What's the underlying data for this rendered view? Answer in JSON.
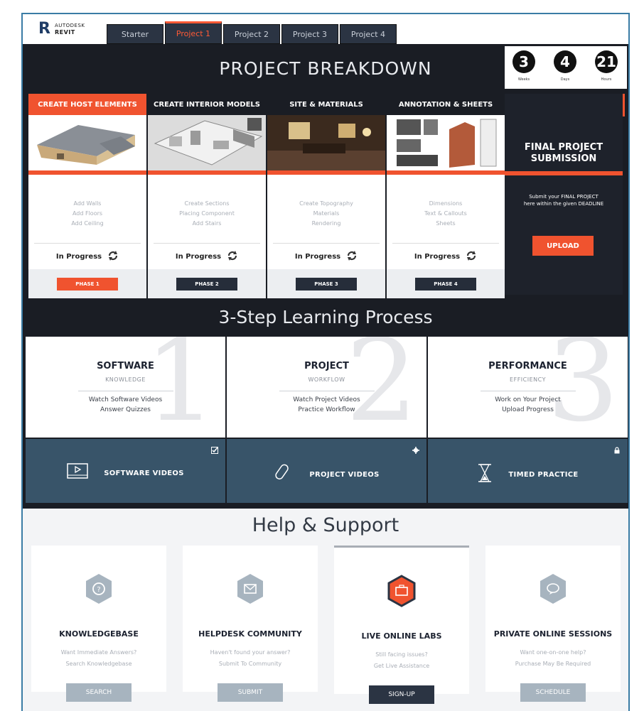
{
  "logo": {
    "mark": "R",
    "line1": "AUTODESK",
    "line2": "REVIT"
  },
  "tabs": [
    {
      "label": "Starter",
      "active": false
    },
    {
      "label": "Project 1",
      "active": true
    },
    {
      "label": "Project 2",
      "active": false
    },
    {
      "label": "Project 3",
      "active": false
    },
    {
      "label": "Project 4",
      "active": false
    }
  ],
  "breakdown": {
    "title": "PROJECT BREAKDOWN"
  },
  "timer": [
    {
      "value": "3",
      "label": "Weeks"
    },
    {
      "value": "4",
      "label": "Days"
    },
    {
      "value": "21",
      "label": "Hours"
    }
  ],
  "phases": [
    {
      "title": "CREATE HOST ELEMENTS",
      "tasks": [
        "Add Walls",
        "Add Floors",
        "Add Ceiling"
      ],
      "status": "In Progress",
      "button": "PHASE 1",
      "active": true
    },
    {
      "title": "CREATE INTERIOR MODELS",
      "tasks": [
        "Create Sections",
        "Placing Component",
        "Add Stairs"
      ],
      "status": "In Progress",
      "button": "PHASE 2",
      "active": false
    },
    {
      "title": "SITE & MATERIALS",
      "tasks": [
        "Create Topography",
        "Materials",
        "Rendering"
      ],
      "status": "In Progress",
      "button": "PHASE 3",
      "active": false
    },
    {
      "title": "ANNOTATION & SHEETS",
      "tasks": [
        "Dimensions",
        "Text & Callouts",
        "Sheets"
      ],
      "status": "In Progress",
      "button": "PHASE 4",
      "active": false
    }
  ],
  "final": {
    "title_line1": "FINAL PROJECT",
    "title_line2": "SUBMISSION",
    "text_line1": "Submit your FINAL PROJECT",
    "text_line2": "here within the given DEADLINE",
    "button": "UPLOAD"
  },
  "learning": {
    "title": "3-Step Learning Process"
  },
  "steps": [
    {
      "number": "1",
      "title": "SOFTWARE",
      "subtitle": "KNOWLEDGE",
      "items": [
        "Watch Software Videos",
        "Answer Quizzes"
      ]
    },
    {
      "number": "2",
      "title": "PROJECT",
      "subtitle": "WORKFLOW",
      "items": [
        "Watch Project Videos",
        "Practice Workflow"
      ]
    },
    {
      "number": "3",
      "title": "PERFORMANCE",
      "subtitle": "EFFICIENCY",
      "items": [
        "Work on Your Project",
        "Upload Progress"
      ]
    }
  ],
  "videos": [
    {
      "label": "SOFTWARE VIDEOS",
      "icon": "video-player-icon",
      "corner_icon": "checkbox-icon"
    },
    {
      "label": "PROJECT VIDEOS",
      "icon": "paperclip-icon",
      "corner_icon": "gear-icon"
    },
    {
      "label": "TIMED PRACTICE",
      "icon": "hourglass-icon",
      "corner_icon": "lock-icon"
    }
  ],
  "help": {
    "title": "Help & Support"
  },
  "support_cards": [
    {
      "title": "KNOWLEDGEBASE",
      "text_line1": "Want Immediate Answers?",
      "text_line2": "Search Knowledgebase",
      "button": "SEARCH",
      "icon": "question-icon"
    },
    {
      "title": "HELPDESK COMMUNITY",
      "text_line1": "Haven't found your answer?",
      "text_line2": "Submit To Community",
      "button": "SUBMIT",
      "icon": "envelope-icon"
    },
    {
      "title": "LIVE ONLINE LABS",
      "text_line1": "Still facing issues?",
      "text_line2": "Get Live Assistance",
      "button": "SIGN-UP",
      "icon": "briefcase-icon"
    },
    {
      "title": "PRIVATE ONLINE SESSIONS",
      "text_line1": "Want one-on-one help?",
      "text_line2": "Purchase May Be Required",
      "button": "SCHEDULE",
      "icon": "chat-icon"
    }
  ],
  "colors": {
    "accent": "#f0532f",
    "dark": "#1a1d24",
    "slate": "#385469",
    "muted_button": "#a7b4bf"
  }
}
